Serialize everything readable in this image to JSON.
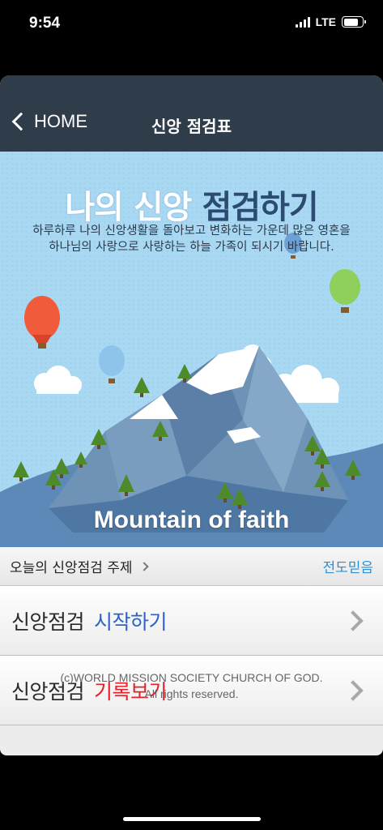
{
  "status_bar": {
    "time": "9:54",
    "network": "LTE",
    "signal_bars": 4,
    "battery_level": 0.8
  },
  "navbar": {
    "back_label": "HOME",
    "title": "신앙 점검표"
  },
  "banner": {
    "title_part1": "나의 신앙",
    "title_part2": "점검하기",
    "description": "하루하루 나의 신앙생활을 돌아보고 변화하는 가운데 많은 영혼을 하나님의 사랑으로 사랑하는 하늘 가족이 되시기 바랍니다.",
    "caption": "Mountain of faith",
    "colors": {
      "sky": "#a9d8f2",
      "mountain": "#6f93b7",
      "snow": "#ffffff",
      "ground": "#5d89b9",
      "tree": "#4f8a2a"
    }
  },
  "topic": {
    "label": "오늘의 신앙점검 주제",
    "value": "전도믿음"
  },
  "menu": {
    "start": {
      "label": "신앙점검",
      "action": "시작하기",
      "color": "#2d63c8"
    },
    "records": {
      "label": "신앙점검",
      "action": "기록보기",
      "color": "#e2232a"
    }
  },
  "footer": {
    "line1": "(c)WORLD MISSION  SOCIETY CHURCH OF GOD.",
    "line2": "All rights reserved."
  }
}
